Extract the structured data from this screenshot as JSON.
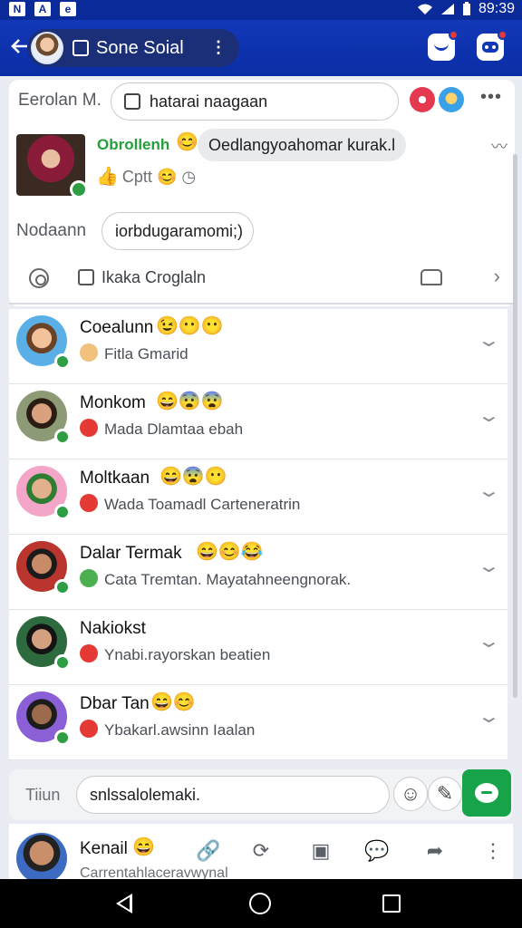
{
  "status_bar": {
    "time": "89:39",
    "left_glyphs": [
      "N",
      "A",
      "e"
    ],
    "accent": "#0a2a9a"
  },
  "app_bar": {
    "title": "Sone Soial",
    "back_icon": "arrow-left-icon",
    "menu_icon": "kebab-icon",
    "accent": "#1238b8"
  },
  "composer": {
    "label": "Eerolan M.",
    "input_text": "hatarai naagaan",
    "post": {
      "author": "Obrollenh",
      "message": "Oedlangyoahomar kurak.l",
      "meta": "Cptt"
    },
    "second_label": "Nodaann",
    "second_field": "iorbdugaramomi;)",
    "action_label": "Ikaka Croglaln"
  },
  "contacts": [
    {
      "name": "Coealunn",
      "emojis": "😉😶😶",
      "sub": "Fitla Gmarid",
      "sub_icon_color": "#f1c27d",
      "avatar": [
        "#6b4226",
        "#f2c29b",
        "#5ab0e6"
      ]
    },
    {
      "name": "Monkom",
      "emojis": "😄😨😨",
      "sub": "Mada Dlamtaa ebah",
      "sub_icon_color": "#e53935",
      "avatar": [
        "#2b1d14",
        "#d9a17e",
        "#8c9a76"
      ]
    },
    {
      "name": "Moltkaan",
      "emojis": "😄😨😶",
      "sub": "Wada Toamadl Carteneratrin",
      "sub_icon_color": "#e53935",
      "avatar": [
        "#2e7d32",
        "#e2b08c",
        "#f3a6c8"
      ]
    },
    {
      "name": "Dalar Termak",
      "emojis": "😄😊😂",
      "sub": "Cata Tremtan. Mayatahneengnorak.",
      "sub_icon_color": "#4caf50",
      "avatar": [
        "#1b1b1b",
        "#c98a67",
        "#b9352e"
      ]
    },
    {
      "name": "Nakiokst",
      "emojis": "",
      "sub": "Ynabi.rayorskan beatien",
      "sub_icon_color": "#e53935",
      "avatar": [
        "#141414",
        "#d5a07f",
        "#2d6a3e"
      ]
    },
    {
      "name": "Dbar Tan",
      "emojis": "😄😊",
      "sub": "Ybakarl.awsinn Iaalan",
      "sub_icon_color": "#e53935",
      "avatar": [
        "#1c1c1c",
        "#9c6a4d",
        "#8b5fd6"
      ]
    }
  ],
  "reply": {
    "label": "Tiiun",
    "input": "snlssalolemaki.",
    "send_color": "#16a34a"
  },
  "bottom": {
    "name": "Kenail",
    "sub": "Carrentahlaceravwynal",
    "icons": [
      "link-icon",
      "refresh-icon",
      "gallery-icon",
      "chat-icon",
      "share-icon",
      "kebab-icon"
    ]
  }
}
